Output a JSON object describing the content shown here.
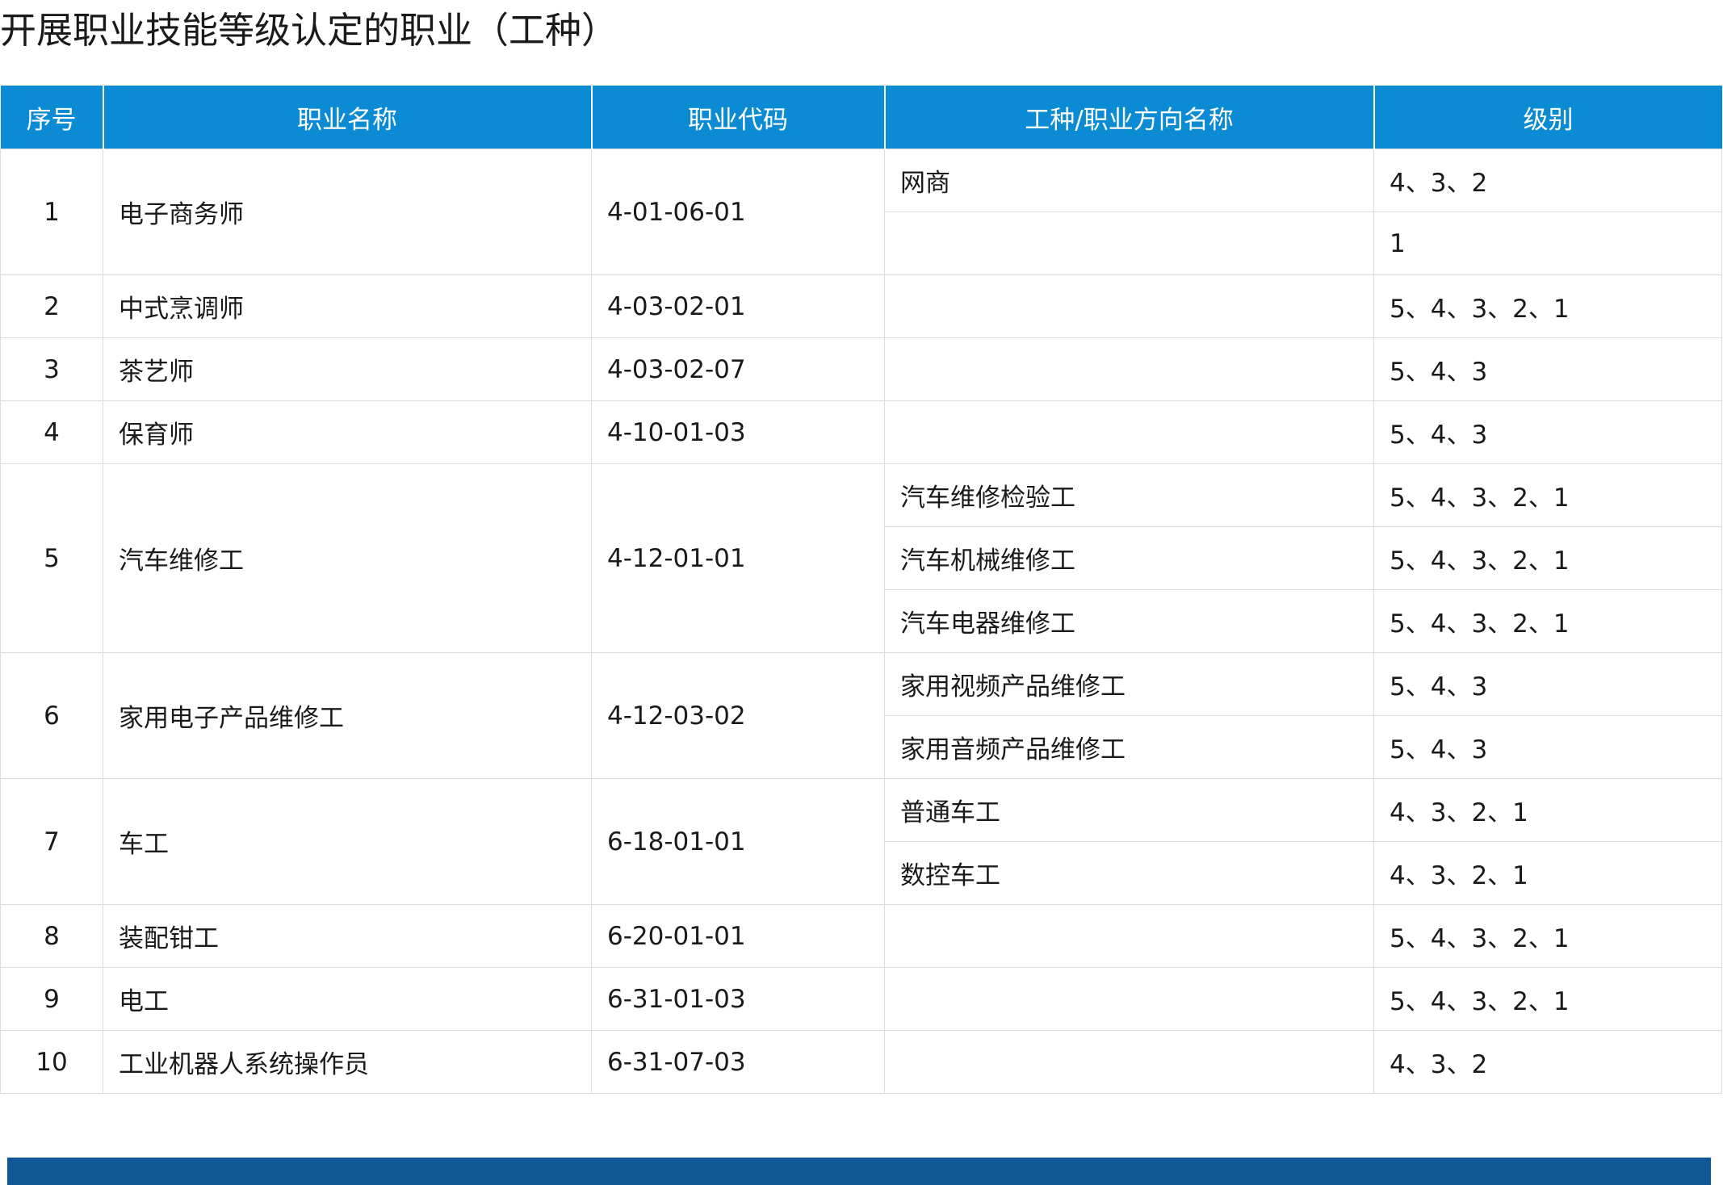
{
  "page": {
    "title": "开展职业技能等级认定的职业（工种）"
  },
  "table": {
    "headers": {
      "seq": "序号",
      "name": "职业名称",
      "code": "职业代码",
      "direction": "工种/职业方向名称",
      "level": "级别"
    },
    "rows": [
      {
        "seq": "1",
        "name": "电子商务师",
        "code": "4-01-06-01",
        "sub": [
          {
            "direction": "网商",
            "level": "4、3、2"
          },
          {
            "direction": "",
            "level": "1"
          }
        ]
      },
      {
        "seq": "2",
        "name": "中式烹调师",
        "code": "4-03-02-01",
        "sub": [
          {
            "direction": "",
            "level": "5、4、3、2、1"
          }
        ]
      },
      {
        "seq": "3",
        "name": "茶艺师",
        "code": "4-03-02-07",
        "sub": [
          {
            "direction": "",
            "level": "5、4、3"
          }
        ]
      },
      {
        "seq": "4",
        "name": "保育师",
        "code": "4-10-01-03",
        "sub": [
          {
            "direction": "",
            "level": "5、4、3"
          }
        ]
      },
      {
        "seq": "5",
        "name": "汽车维修工",
        "code": "4-12-01-01",
        "sub": [
          {
            "direction": "汽车维修检验工",
            "level": "5、4、3、2、1"
          },
          {
            "direction": "汽车机械维修工",
            "level": "5、4、3、2、1"
          },
          {
            "direction": "汽车电器维修工",
            "level": "5、4、3、2、1"
          }
        ]
      },
      {
        "seq": "6",
        "name": "家用电子产品维修工",
        "code": "4-12-03-02",
        "sub": [
          {
            "direction": "家用视频产品维修工",
            "level": "5、4、3"
          },
          {
            "direction": "家用音频产品维修工",
            "level": "5、4、3"
          }
        ]
      },
      {
        "seq": "7",
        "name": "车工",
        "code": "6-18-01-01",
        "sub": [
          {
            "direction": "普通车工",
            "level": "4、3、2、1"
          },
          {
            "direction": "数控车工",
            "level": "4、3、2、1"
          }
        ]
      },
      {
        "seq": "8",
        "name": "装配钳工",
        "code": "6-20-01-01",
        "sub": [
          {
            "direction": "",
            "level": "5、4、3、2、1"
          }
        ]
      },
      {
        "seq": "9",
        "name": "电工",
        "code": "6-31-01-03",
        "sub": [
          {
            "direction": "",
            "level": "5、4、3、2、1"
          }
        ]
      },
      {
        "seq": "10",
        "name": "工业机器人系统操作员",
        "code": "6-31-07-03",
        "sub": [
          {
            "direction": "",
            "level": "4、3、2"
          }
        ]
      }
    ]
  },
  "colors": {
    "header_bg": "#0b8bd3",
    "header_text": "#ffffff",
    "footer_bar": "#0f5797",
    "grid_line": "#dcdcdc"
  }
}
